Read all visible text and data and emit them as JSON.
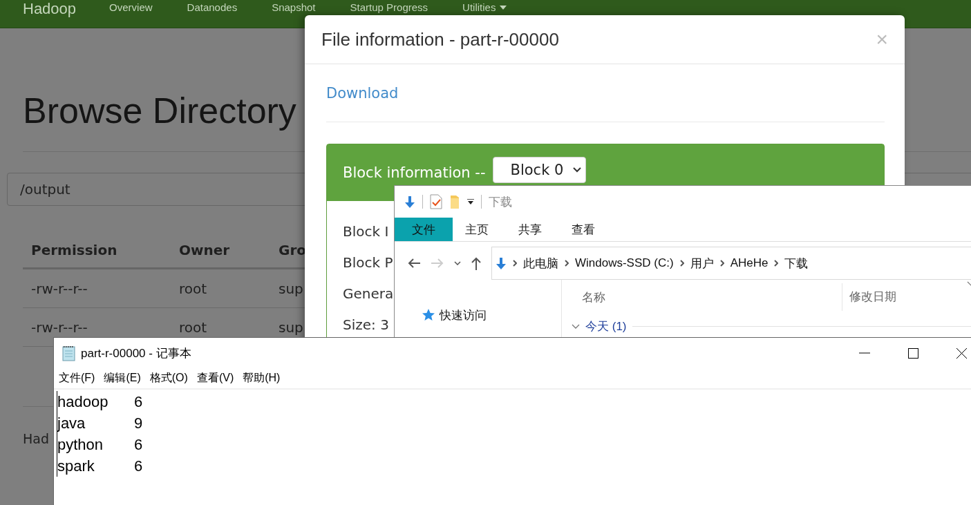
{
  "hadoop_page": {
    "navbar": {
      "brand": "Hadoop",
      "items": [
        {
          "label": "Overview",
          "dropdown": false
        },
        {
          "label": "Datanodes",
          "dropdown": false
        },
        {
          "label": "Snapshot",
          "dropdown": false
        },
        {
          "label": "Startup Progress",
          "dropdown": false
        },
        {
          "label": "Utilities",
          "dropdown": true
        }
      ]
    },
    "title": "Browse Directory",
    "path_field": {
      "value": "/output"
    },
    "table": {
      "columns": [
        "Permission",
        "Owner",
        "Gro"
      ],
      "rows": [
        [
          "-rw-r--r--",
          "root",
          "sup"
        ],
        [
          "-rw-r--r--",
          "root",
          "sup"
        ]
      ]
    },
    "footer": "Had"
  },
  "modal": {
    "title": "File information - part-r-00000",
    "close": "×",
    "download_link": "Download",
    "panel": {
      "title": "Block information --",
      "block_select": {
        "value": "Block 0"
      },
      "fields": [
        "Block I",
        "Block P",
        "Genera",
        "Size: 3"
      ]
    }
  },
  "explorer": {
    "quick_access_title": "下载",
    "ribbon_tabs": [
      {
        "label": "文件",
        "selected": true
      },
      {
        "label": "主页",
        "selected": false
      },
      {
        "label": "共享",
        "selected": false
      },
      {
        "label": "查看",
        "selected": false
      }
    ],
    "breadcrumbs": [
      "此电脑",
      "Windows-SSD (C:)",
      "用户",
      "AHeHe",
      "下载"
    ],
    "nav_items": [
      "快速访问"
    ],
    "columns": [
      "名称",
      "修改日期"
    ],
    "groups": [
      {
        "label": "今天 (1)",
        "expanded": true
      }
    ]
  },
  "notepad": {
    "title": "part-r-00000 - 记事本",
    "menu": [
      "文件(F)",
      "编辑(E)",
      "格式(O)",
      "查看(V)",
      "帮助(H)"
    ],
    "content": "hadoop\t6\njava\t9\npython\t6\nspark\t6"
  }
}
